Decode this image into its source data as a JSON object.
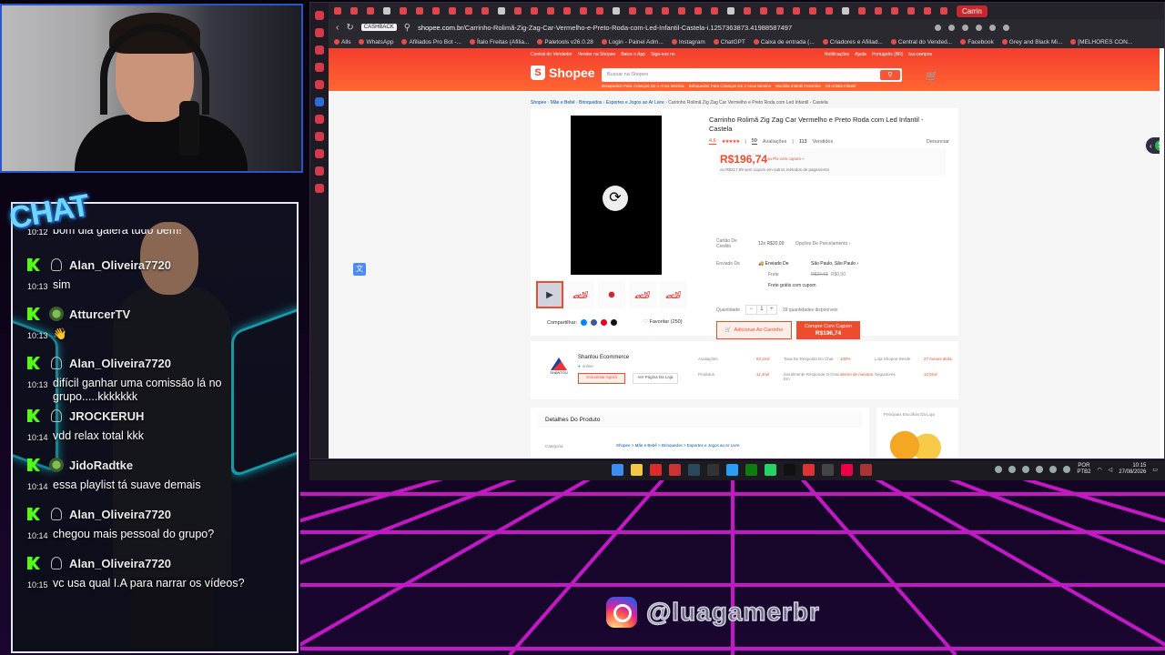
{
  "chat": {
    "badge": "CHAT",
    "partial_message": "bom dia galera tudo bem!",
    "partial_time": "10:12",
    "messages": [
      {
        "user": "Alan_Oliveira7720",
        "time": "10:13",
        "text": "sim",
        "avatar": "person"
      },
      {
        "user": "AtturcerTV",
        "time": "10:13",
        "text": "👋",
        "avatar": "round"
      },
      {
        "user": "Alan_Oliveira7720",
        "time": "10:13",
        "text": "difícil ganhar uma comissão lá no grupo.....kkkkkkk",
        "avatar": "person"
      },
      {
        "user": "JROCKERUH",
        "time": "10:14",
        "text": "vdd relax total kkk",
        "avatar": "person"
      },
      {
        "user": "JidoRadtke",
        "time": "10:14",
        "text": "essa playlist tá suave demais",
        "avatar": "round"
      },
      {
        "user": "Alan_Oliveira7720",
        "time": "10:14",
        "text": "chegou mais pessoal do grupo?",
        "avatar": "person"
      },
      {
        "user": "Alan_Oliveira7720",
        "time": "10:15",
        "text": "vc usa qual I.A para narrar os vídeos?",
        "avatar": "person"
      }
    ]
  },
  "browser": {
    "active_tab": "Carrin",
    "cashback": "CASHBACK",
    "url_host": "shopee.com.br",
    "url_path": "/Carrinho-Rolimã-Zig-Zag-Car-Vermelho-e-Preto-Roda-com-Led-Infantil-Castela-i.1257363873.41988587497",
    "bookmarks": [
      "Alls",
      "WhatsApp",
      "Afiliados Pro Bot -...",
      "Ítalo Freitas (Afilia...",
      "Paletools v26.0.28",
      "Login - Painel Adm...",
      "Instagram",
      "ChatGPT",
      "Caixa de entrada (...",
      "Criadores e Afiliad...",
      "Central do Vended...",
      "Facebook",
      "Grey and Black Mi...",
      "[MELHORES CON..."
    ]
  },
  "shopee": {
    "top_left": [
      "Central do Vendedor",
      "Vender na Shopee",
      "Baixe o App",
      "Siga-nos no"
    ],
    "top_right": [
      "Notificações",
      "Ajuda",
      "Português (BR)",
      "lua.campos"
    ],
    "logo": "Shopee",
    "search_placeholder": "Buscar na Shopee",
    "sub_links": [
      "Brinquedos Para Crianças De 2 Anos Menina",
      "Brinquedos Para Crianças De 3 Anos Menino",
      "Mochila Infantil Feminina",
      "Kit Artista Infantil"
    ],
    "breadcrumb": [
      "Shopee",
      "Mãe e Bebê",
      "Brinquedos",
      "Esportes e Jogos ao Ar Livre"
    ],
    "breadcrumb_current": "Carrinho Rolimã Zig Zag Car Vermelho e Preto Roda com Led Infantil - Castela",
    "title": "Carrinho Rolimã Zig Zag Car Vermelho e Preto Roda com Led Infantil - Castela",
    "rating": "4.6",
    "reviews_count": "59",
    "reviews_label": "Avaliações",
    "sold_count": "113",
    "sold_label": "Vendidos",
    "report": "Denunciar",
    "price": "R$196,74",
    "coupon_note": "ao Pix com cupom »",
    "alt_price": "ou R$217,99 sem cupom em outros métodos de pagamento",
    "card_label": "Cartão De Crédito",
    "installments": "12x R$20,09",
    "installments_link": "Opções De Parcelamento ›",
    "shipping_label": "Enviado De",
    "shipping_sub": "Enviado De",
    "shipping_city": "São Paulo, São Paulo ›",
    "freight_label": "Frete",
    "freight_old": "R$27,61",
    "freight_new": "R$0,00",
    "free_shipping": "Frete grátis com cupom",
    "qty_label": "Quantidade",
    "qty_value": "1",
    "stock": "39 quantidades disponíveis",
    "add_cart": "Adicionar Ao Carrinho",
    "buy_line1": "Compre Com Cupom",
    "buy_line2": "R$196,74",
    "share": "Compartilhar:",
    "favorite": "Favoritar (250)",
    "shop_name": "Shantou Ecommerce",
    "shop_logo_text": "SHANTOU",
    "online": "online",
    "chat_now": "Conversar Agora",
    "view_shop": "Ver Página Da Loja",
    "stats": [
      {
        "label": "Avaliações",
        "value": "82,2mil"
      },
      {
        "label": "Taxa De Resposta Do Chat",
        "value": "100%"
      },
      {
        "label": "Loja Shopee Desde",
        "value": "27 meses atrás"
      },
      {
        "label": "Produtos",
        "value": "11,4mil"
      },
      {
        "label": "Geralmente Responde O Chat Em",
        "value": "dentro de minutos"
      },
      {
        "label": "Seguidores",
        "value": "12,5mil"
      }
    ],
    "details_header": "Detalhes Do Produto",
    "category_label": "Categoria",
    "category_path": "Shopee > Mãe e Bebê > Brinquedos > Esportes e Jogos ao Ar Livre",
    "side_header": "Principais Escolhas Da Loja"
  },
  "taskbar": {
    "lang1": "POR",
    "lang2": "PTB2",
    "time": "10:15",
    "date": "27/08/2026"
  },
  "instagram_handle": "@luagamerbr"
}
